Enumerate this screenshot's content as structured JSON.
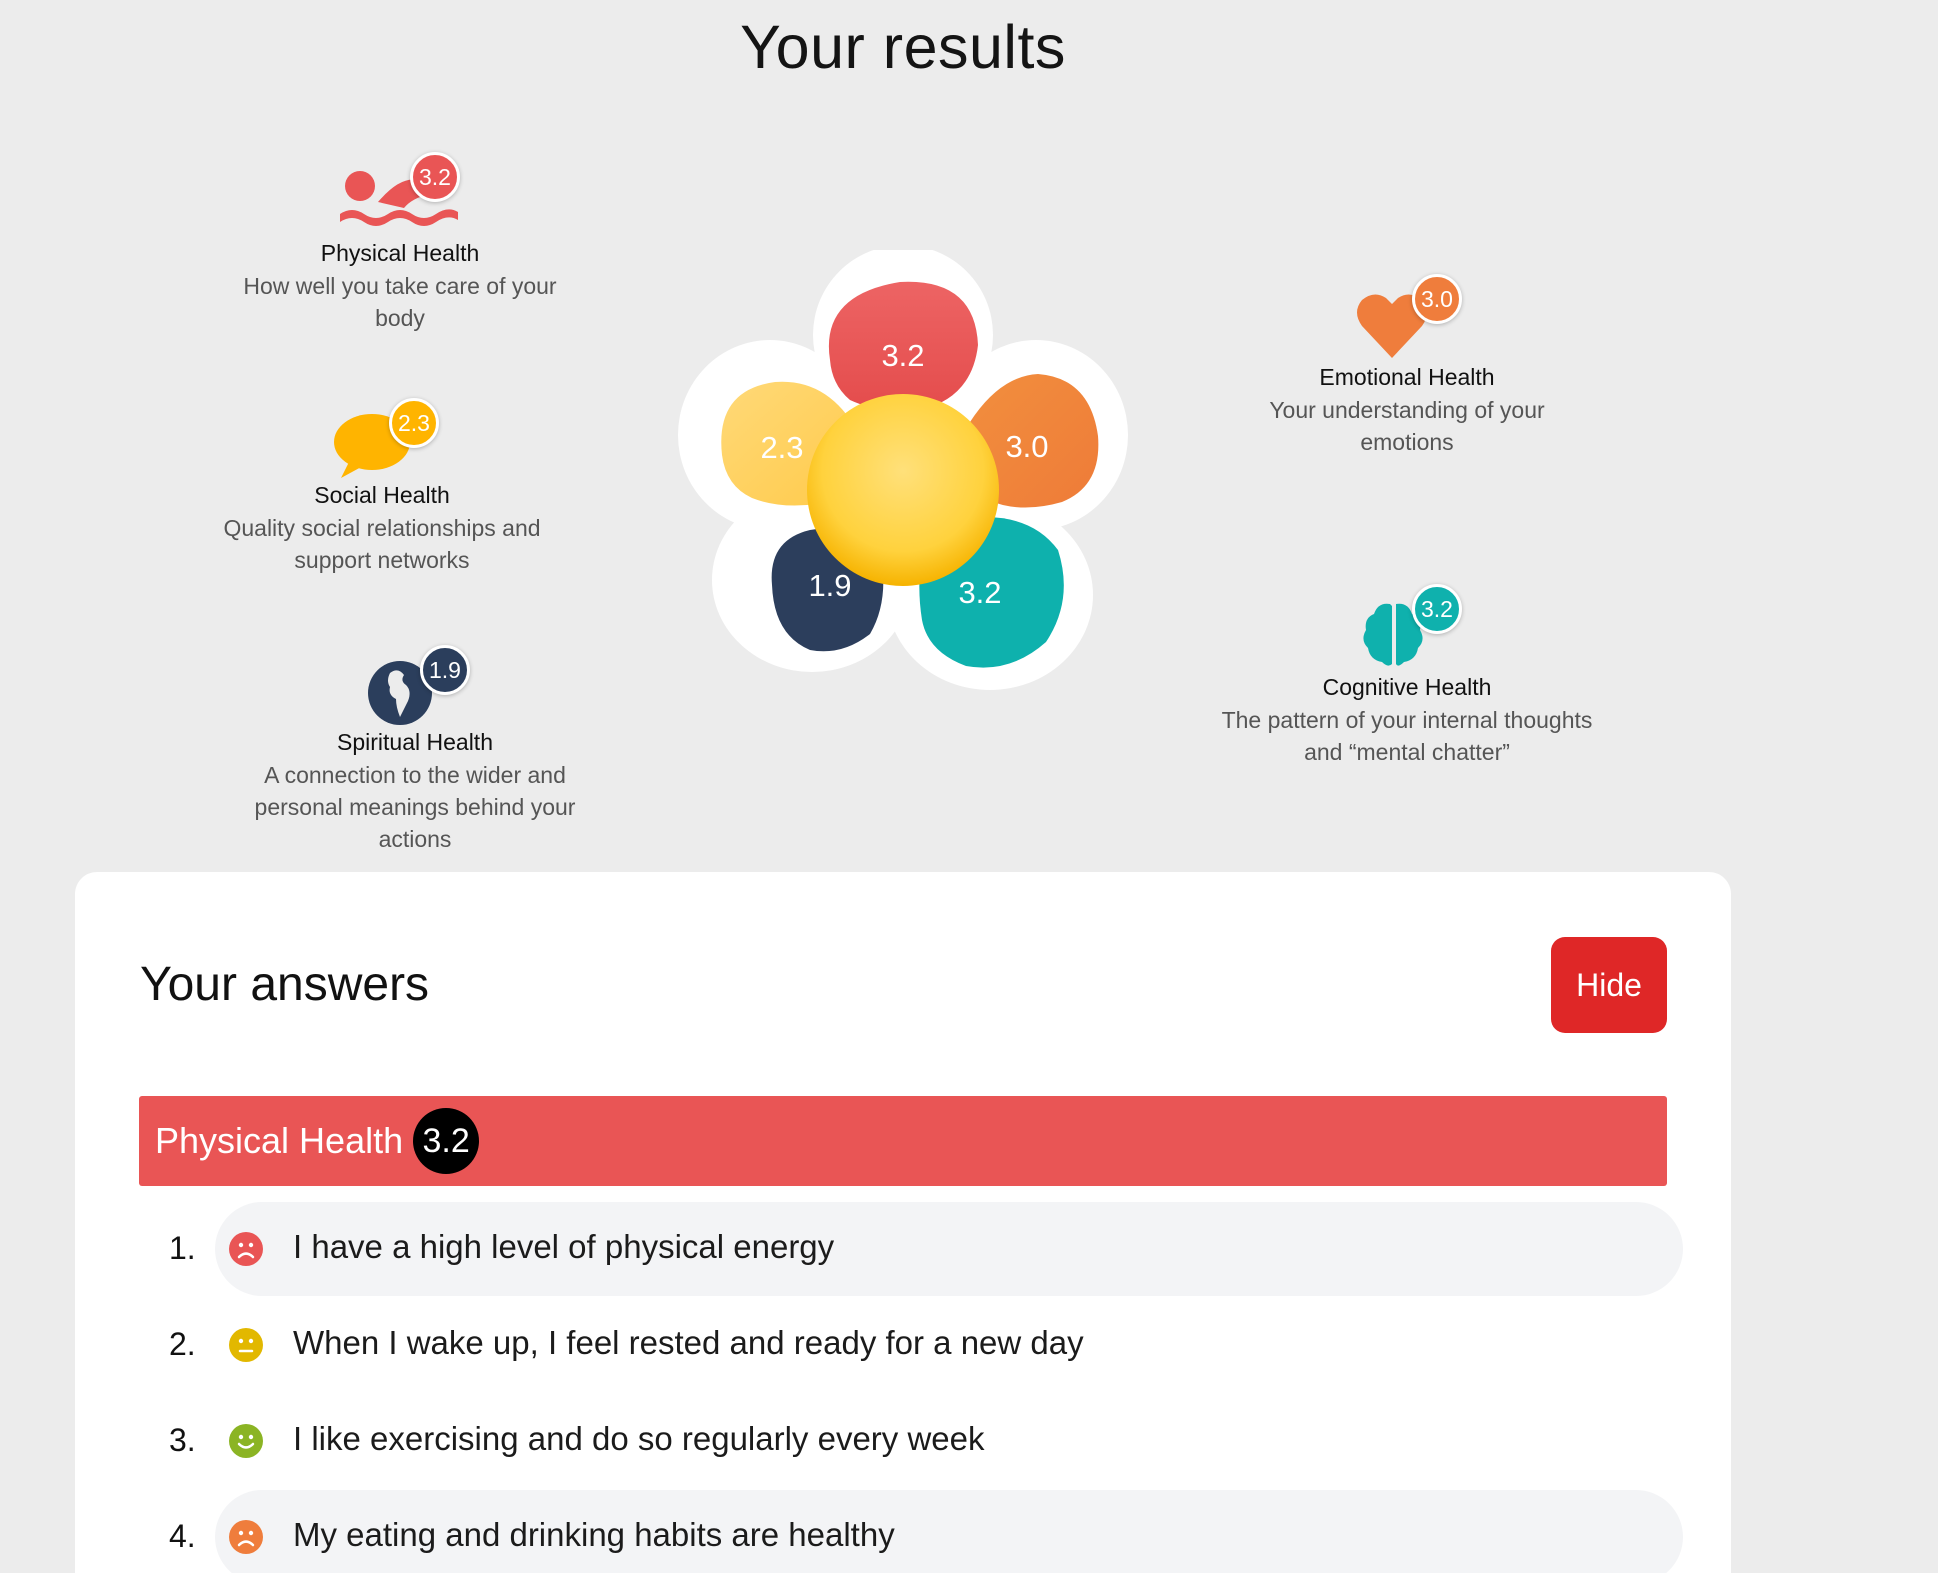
{
  "page_title": "Your results",
  "categories": {
    "physical": {
      "name": "Physical Health",
      "score": "3.2",
      "desc_1": "How well you take care of your",
      "desc_2": "body",
      "color": "#e95555"
    },
    "social": {
      "name": "Social Health",
      "score": "2.3",
      "desc_1": "Quality social relationships and",
      "desc_2": "support networks",
      "color": "#ffb400"
    },
    "spiritual": {
      "name": "Spiritual Health",
      "score": "1.9",
      "desc_1": "A connection to the wider and",
      "desc_2": "personal meanings behind your",
      "desc_3": "actions",
      "color": "#2b3e5c"
    },
    "emotional": {
      "name": "Emotional Health",
      "score": "3.0",
      "desc_1": "Your understanding of your",
      "desc_2": "emotions",
      "color": "#ef7d3c"
    },
    "cognitive": {
      "name": "Cognitive Health",
      "score": "3.2",
      "desc_1": "The pattern of your internal thoughts",
      "desc_2": "and “mental chatter”",
      "color": "#0fb1ad"
    }
  },
  "flower": {
    "top": "3.2",
    "left": "2.3",
    "right": "3.0",
    "bottom_left": "1.9",
    "bottom_right": "3.2"
  },
  "answers": {
    "title": "Your answers",
    "hide_label": "Hide",
    "section": {
      "label": "Physical Health",
      "score": "3.2"
    },
    "questions": [
      {
        "num": "1.",
        "text": "I have a high level of physical energy",
        "mood": "sad",
        "face_color": "#e95555"
      },
      {
        "num": "2.",
        "text": "When I wake up, I feel rested and ready for a new day",
        "mood": "neutral",
        "face_color": "#e2b800"
      },
      {
        "num": "3.",
        "text": "I like exercising and do so regularly every week",
        "mood": "happy",
        "face_color": "#8bb424"
      },
      {
        "num": "4.",
        "text": "My eating and drinking habits are healthy",
        "mood": "sad",
        "face_color": "#ef7d3c"
      }
    ]
  }
}
